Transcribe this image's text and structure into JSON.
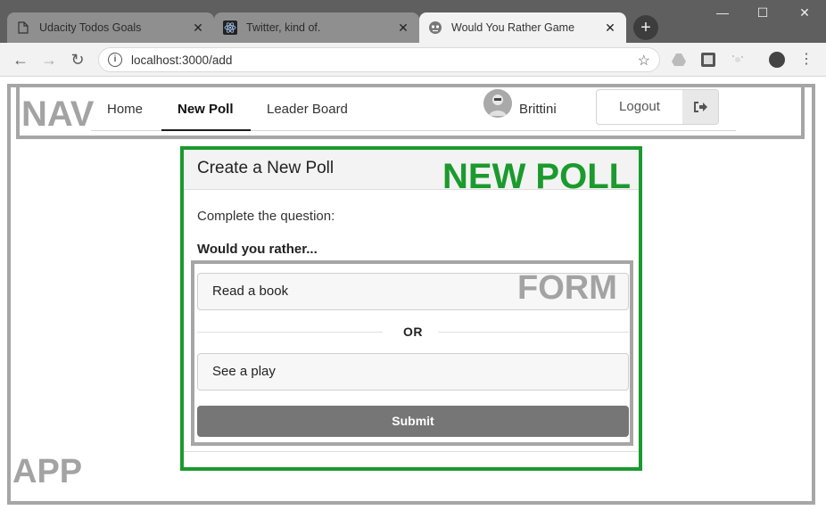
{
  "browser": {
    "tabs": [
      {
        "title": "Udacity Todos Goals",
        "icon": "document-icon",
        "active": false
      },
      {
        "title": "Twitter, kind of.",
        "icon": "react-icon",
        "active": false
      },
      {
        "title": "Would You Rather Game",
        "icon": "poll-icon",
        "active": true
      }
    ],
    "url": "localhost:3000/add"
  },
  "annotations": {
    "app": "APP",
    "nav": "NAV",
    "new_poll": "NEW POLL",
    "form": "FORM"
  },
  "nav": {
    "items": [
      {
        "label": "Home",
        "active": false
      },
      {
        "label": "New Poll",
        "active": true
      },
      {
        "label": "Leader Board",
        "active": false
      }
    ],
    "user_name": "Brittini",
    "logout_label": "Logout"
  },
  "new_poll": {
    "header": "Create a New Poll",
    "prompt": "Complete the question:",
    "subprompt": "Would you rather...",
    "option_one": "Read a book",
    "divider": "OR",
    "option_two": "See a play",
    "submit_label": "Submit"
  },
  "colors": {
    "annotation_gray": "#a6a6a6",
    "annotation_green": "#1b9a2d",
    "submit_bg": "#767676"
  }
}
